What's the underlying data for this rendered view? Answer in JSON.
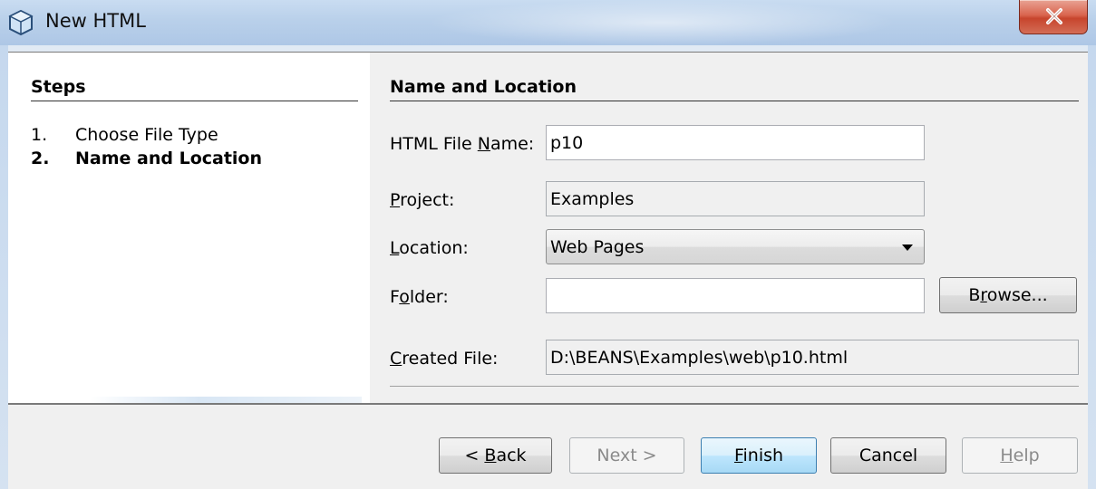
{
  "window": {
    "title": "New HTML"
  },
  "steps": {
    "title": "Steps",
    "items": [
      {
        "num": "1.",
        "label": "Choose File Type",
        "current": false
      },
      {
        "num": "2.",
        "label": "Name and Location",
        "current": true
      }
    ]
  },
  "panel": {
    "title": "Name and Location",
    "html_file_name": {
      "label_pre": "HTML File ",
      "label_mn": "N",
      "label_post": "ame:",
      "value": "p10"
    },
    "project": {
      "label_mn": "P",
      "label_post": "roject:",
      "value": "Examples"
    },
    "location": {
      "label_mn": "L",
      "label_post": "ocation:",
      "value": "Web Pages"
    },
    "folder": {
      "label_pre": "F",
      "label_mn": "o",
      "label_post": "lder:",
      "value": ""
    },
    "browse": {
      "pre": "B",
      "mn": "r",
      "post": "owse..."
    },
    "created_file": {
      "label_mn": "C",
      "label_post": "reated File:",
      "value": "D:\\BEANS\\Examples\\web\\p10.html"
    }
  },
  "buttons": {
    "back": {
      "pre": "< ",
      "mn": "B",
      "post": "ack"
    },
    "next": "Next >",
    "finish": {
      "mn": "F",
      "post": "inish"
    },
    "cancel": "Cancel",
    "help": {
      "mn": "H",
      "post": "elp"
    }
  },
  "icons": {
    "app": "netbeans-cube-icon",
    "close": "close-icon",
    "dropdown": "chevron-down-icon"
  }
}
